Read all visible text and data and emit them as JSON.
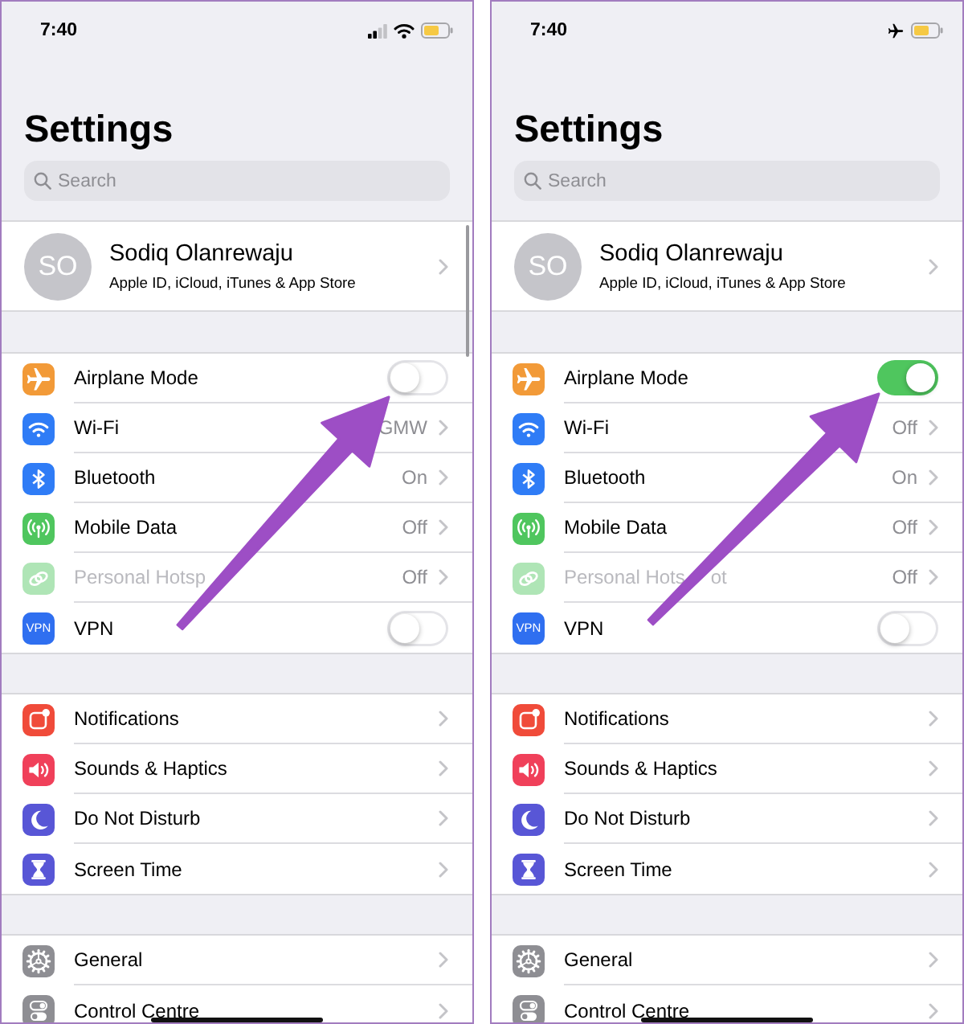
{
  "phones": [
    {
      "status_bar": {
        "time": "7:40"
      },
      "title": "Settings",
      "search": {
        "placeholder": "Search"
      },
      "profile": {
        "initials": "SO",
        "name": "Sodiq Olanrewaju",
        "subtitle": "Apple ID, iCloud, iTunes & App Store"
      },
      "groups": [
        {
          "rows": [
            {
              "label": "Airplane Mode",
              "kind": "toggle",
              "on": false,
              "disabled": false
            },
            {
              "label": "Wi-Fi",
              "kind": "link",
              "value": "GMW",
              "disabled": false
            },
            {
              "label": "Bluetooth",
              "kind": "link",
              "value": "On",
              "disabled": false
            },
            {
              "label": "Mobile Data",
              "kind": "link",
              "value": "Off",
              "disabled": false
            },
            {
              "label": "Personal Hotsp",
              "kind": "link",
              "value": "Off",
              "disabled": true
            },
            {
              "label": "VPN",
              "kind": "toggle",
              "on": false,
              "disabled": false,
              "icon_label": "VPN"
            }
          ]
        },
        {
          "rows": [
            {
              "label": "Notifications",
              "kind": "link"
            },
            {
              "label": "Sounds & Haptics",
              "kind": "link"
            },
            {
              "label": "Do Not Disturb",
              "kind": "link"
            },
            {
              "label": "Screen Time",
              "kind": "link"
            }
          ]
        },
        {
          "rows": [
            {
              "label": "General",
              "kind": "link"
            },
            {
              "label": "Control Centre",
              "kind": "link"
            }
          ]
        }
      ]
    },
    {
      "status_bar": {
        "time": "7:40"
      },
      "title": "Settings",
      "search": {
        "placeholder": "Search"
      },
      "profile": {
        "initials": "SO",
        "name": "Sodiq Olanrewaju",
        "subtitle": "Apple ID, iCloud, iTunes & App Store"
      },
      "groups": [
        {
          "rows": [
            {
              "label": "Airplane Mode",
              "kind": "toggle",
              "on": true,
              "disabled": false
            },
            {
              "label": "Wi-Fi",
              "kind": "link",
              "value": "Off",
              "disabled": false
            },
            {
              "label": "Bluetooth",
              "kind": "link",
              "value": "On",
              "disabled": false
            },
            {
              "label": "Mobile Data",
              "kind": "link",
              "value": "Off",
              "disabled": false
            },
            {
              "label": "Personal Hots",
              "label_tail": "ot",
              "kind": "link",
              "value": "Off",
              "disabled": true
            },
            {
              "label": "VPN",
              "kind": "toggle",
              "on": false,
              "disabled": false,
              "icon_label": "VPN"
            }
          ]
        },
        {
          "rows": [
            {
              "label": "Notifications",
              "kind": "link"
            },
            {
              "label": "Sounds & Haptics",
              "kind": "link"
            },
            {
              "label": "Do Not Disturb",
              "kind": "link"
            },
            {
              "label": "Screen Time",
              "kind": "link"
            }
          ]
        },
        {
          "rows": [
            {
              "label": "General",
              "kind": "link"
            },
            {
              "label": "Control Centre",
              "kind": "link"
            }
          ]
        }
      ]
    }
  ]
}
